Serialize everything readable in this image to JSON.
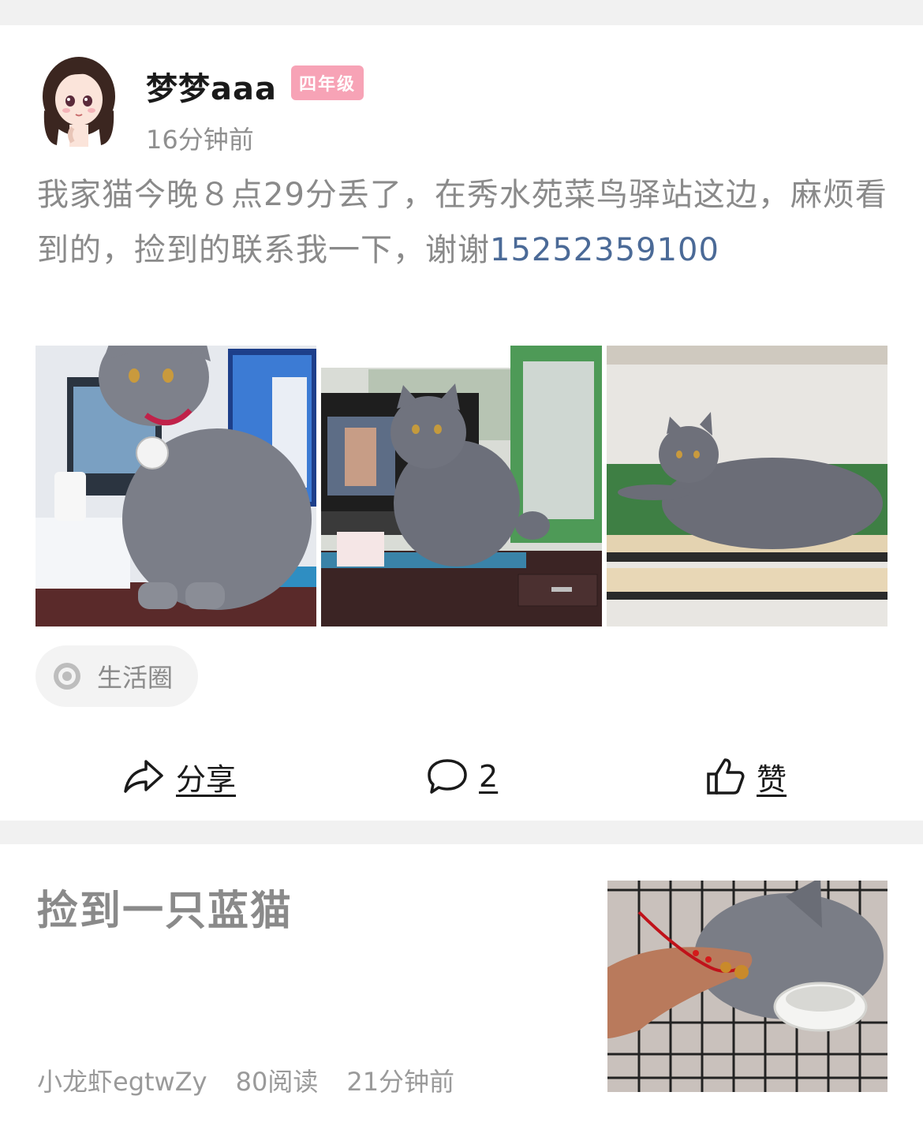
{
  "post": {
    "author": {
      "name": "梦梦aaa",
      "level": "四年级"
    },
    "time": "16分钟前",
    "text": "我家猫今晚８点29分丢了，在秀水苑菜鸟驿站这边，麻烦看到的，捡到的联系我一下，谢谢",
    "phone": "15252359100",
    "topic": {
      "label": "生活圈",
      "icon": "target-icon"
    },
    "actions": {
      "share": {
        "label": "分享",
        "icon": "share-arrow-icon"
      },
      "comment": {
        "label": "2",
        "icon": "comment-bubble-icon"
      },
      "like": {
        "label": "赞",
        "icon": "thumbs-up-icon"
      }
    }
  },
  "related": {
    "title": "捡到一只蓝猫",
    "author": "小龙虾egtwZy",
    "reads": "80阅读",
    "time": "21分钟前"
  },
  "colors": {
    "phone_link": "#4b6a97",
    "badge": "#f7a3b6",
    "gap": "#f1f1f1"
  }
}
